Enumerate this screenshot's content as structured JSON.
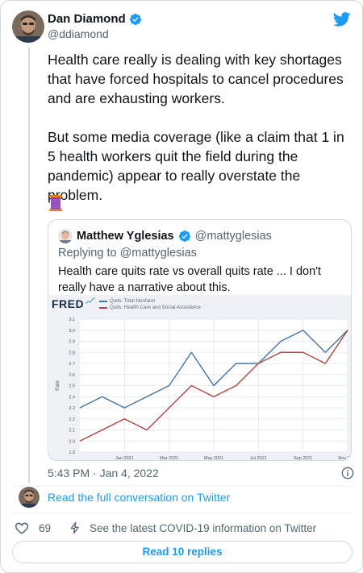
{
  "tweet": {
    "author_name": "Dan Diamond",
    "author_handle": "@ddiamond",
    "text": "Health care really is dealing with key shortages that have forced hospitals to cancel procedures and are exhausting workers.\n\nBut some media coverage (like a claim that 1 in 5 health workers quit the field during the pandemic) appear to really overstate the problem.",
    "emoji": "thread-spool",
    "timestamp": "5:43 PM · Jan 4, 2022",
    "like_count": "69",
    "covid_link": "See the latest COVID-19 information on Twitter",
    "read_full": "Read the full conversation on Twitter",
    "read_replies": "Read 10 replies"
  },
  "quote": {
    "author_name": "Matthew Yglesias",
    "author_handle": "@mattyglesias",
    "replying_prefix": "Replying to ",
    "replying_handle": "@mattyglesias",
    "text": "Health care quits rate vs overall quits rate ... I don't really have a narrative about this."
  },
  "colors": {
    "accent": "#1d9bf0",
    "verified": "#1d9bf0",
    "series_nonfarm": "#4572a7",
    "series_health": "#aa4643"
  },
  "chart_data": {
    "type": "line",
    "logo": "FRED",
    "legend": [
      "Quits: Total Nonfarm",
      "Quits: Health Care and Social Assistance"
    ],
    "ylabel": "Rate",
    "ylim": [
      1.9,
      3.1
    ],
    "yticks": [
      "1.9",
      "2.0",
      "2.1",
      "2.2",
      "2.3",
      "2.4",
      "2.5",
      "2.6",
      "2.7",
      "2.8",
      "2.9",
      "3.0",
      "3.1"
    ],
    "xticks": [
      "Jan 2021",
      "Mar 2021",
      "May 2021",
      "Jul 2021",
      "Sep 2021",
      "Nov 2021"
    ],
    "x": [
      "Nov 2020",
      "Dec 2020",
      "Jan 2021",
      "Feb 2021",
      "Mar 2021",
      "Apr 2021",
      "May 2021",
      "Jun 2021",
      "Jul 2021",
      "Aug 2021",
      "Sep 2021",
      "Oct 2021",
      "Nov 2021"
    ],
    "series": [
      {
        "name": "Quits: Total Nonfarm",
        "values": [
          2.3,
          2.4,
          2.3,
          2.4,
          2.5,
          2.8,
          2.5,
          2.7,
          2.7,
          2.9,
          3.0,
          2.8,
          3.0
        ]
      },
      {
        "name": "Quits: Health Care and Social Assistance",
        "values": [
          2.0,
          2.1,
          2.2,
          2.1,
          2.3,
          2.5,
          2.4,
          2.5,
          2.7,
          2.8,
          2.8,
          2.7,
          3.0
        ]
      }
    ]
  }
}
